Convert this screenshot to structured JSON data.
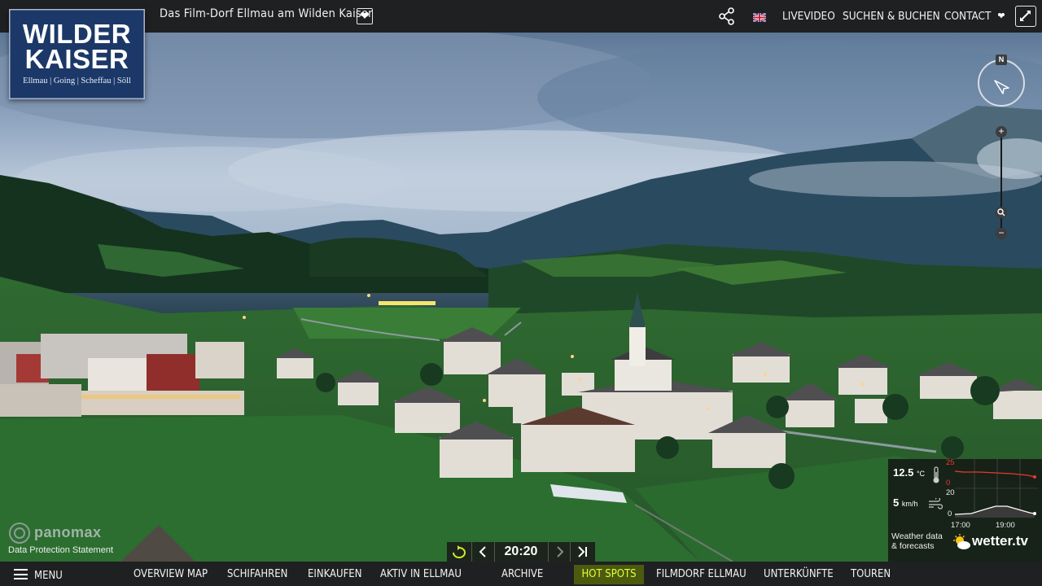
{
  "header": {
    "title": "Das Film-Dorf Ellmau am Wilden Kaiser",
    "nav": [
      "LIVEVIDEO",
      "SUCHEN & BUCHEN",
      "CONTACT"
    ],
    "icons": {
      "share": "share-icon",
      "flag": "uk-flag-icon",
      "toggle": "chevron-down-icon",
      "fullscreen": "fullscreen-icon"
    }
  },
  "logo": {
    "line1": "WILDER",
    "line2": "KAISER",
    "sub": "Ellmau | Going | Scheffau | Söll",
    "bg_color": "#1b3868"
  },
  "compass": {
    "label": "N"
  },
  "zoom": {
    "plus": "+",
    "minus": "−"
  },
  "weather": {
    "temperature": "12.5",
    "temperature_unit": "°C",
    "wind": "5",
    "wind_unit": "km/h",
    "temp_axis": [
      "25",
      "0"
    ],
    "wind_axis": [
      "20",
      "0"
    ],
    "times": [
      "17:00",
      "19:00"
    ],
    "source_line1": "Weather data",
    "source_line2": "& forecasts",
    "brand": "wetter.tv",
    "temp_color": "#e8392f"
  },
  "timenav": {
    "time": "20:20"
  },
  "footer_left": {
    "privacy": "Data Protection Statement",
    "brand": "panomax"
  },
  "bottom": {
    "menu": "MENU",
    "items": [
      "OVERVIEW MAP",
      "SCHIFAHREN",
      "EINKAUFEN",
      "AKTIV IN ELLMAU",
      "ARCHIVE",
      "HOT SPOTS",
      "FILMDORF ELLMAU",
      "UNTERKÜNFTE",
      "TOUREN"
    ],
    "active_color": "#e2ff3a"
  }
}
